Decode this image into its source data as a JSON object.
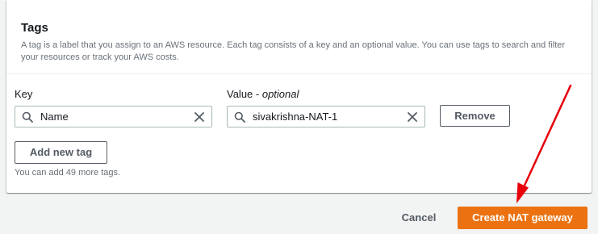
{
  "tags_section": {
    "title": "Tags",
    "description": "A tag is a label that you assign to an AWS resource. Each tag consists of a key and an optional value. You can use tags to search and filter your resources or track your AWS costs.",
    "key_label": "Key",
    "value_label_main": "Value - ",
    "value_label_optional": "optional",
    "tag": {
      "key": "Name",
      "value": "sivakrishna-NAT-1"
    },
    "remove_label": "Remove",
    "add_label": "Add new tag",
    "hint": "You can add 49 more tags."
  },
  "footer": {
    "cancel_label": "Cancel",
    "create_label": "Create NAT gateway"
  },
  "colors": {
    "primary": "#ec7211",
    "annotation_arrow": "#e8000b"
  },
  "icons": {
    "search": "search-icon",
    "clear": "close-icon",
    "annotation": "red-arrow-icon"
  }
}
